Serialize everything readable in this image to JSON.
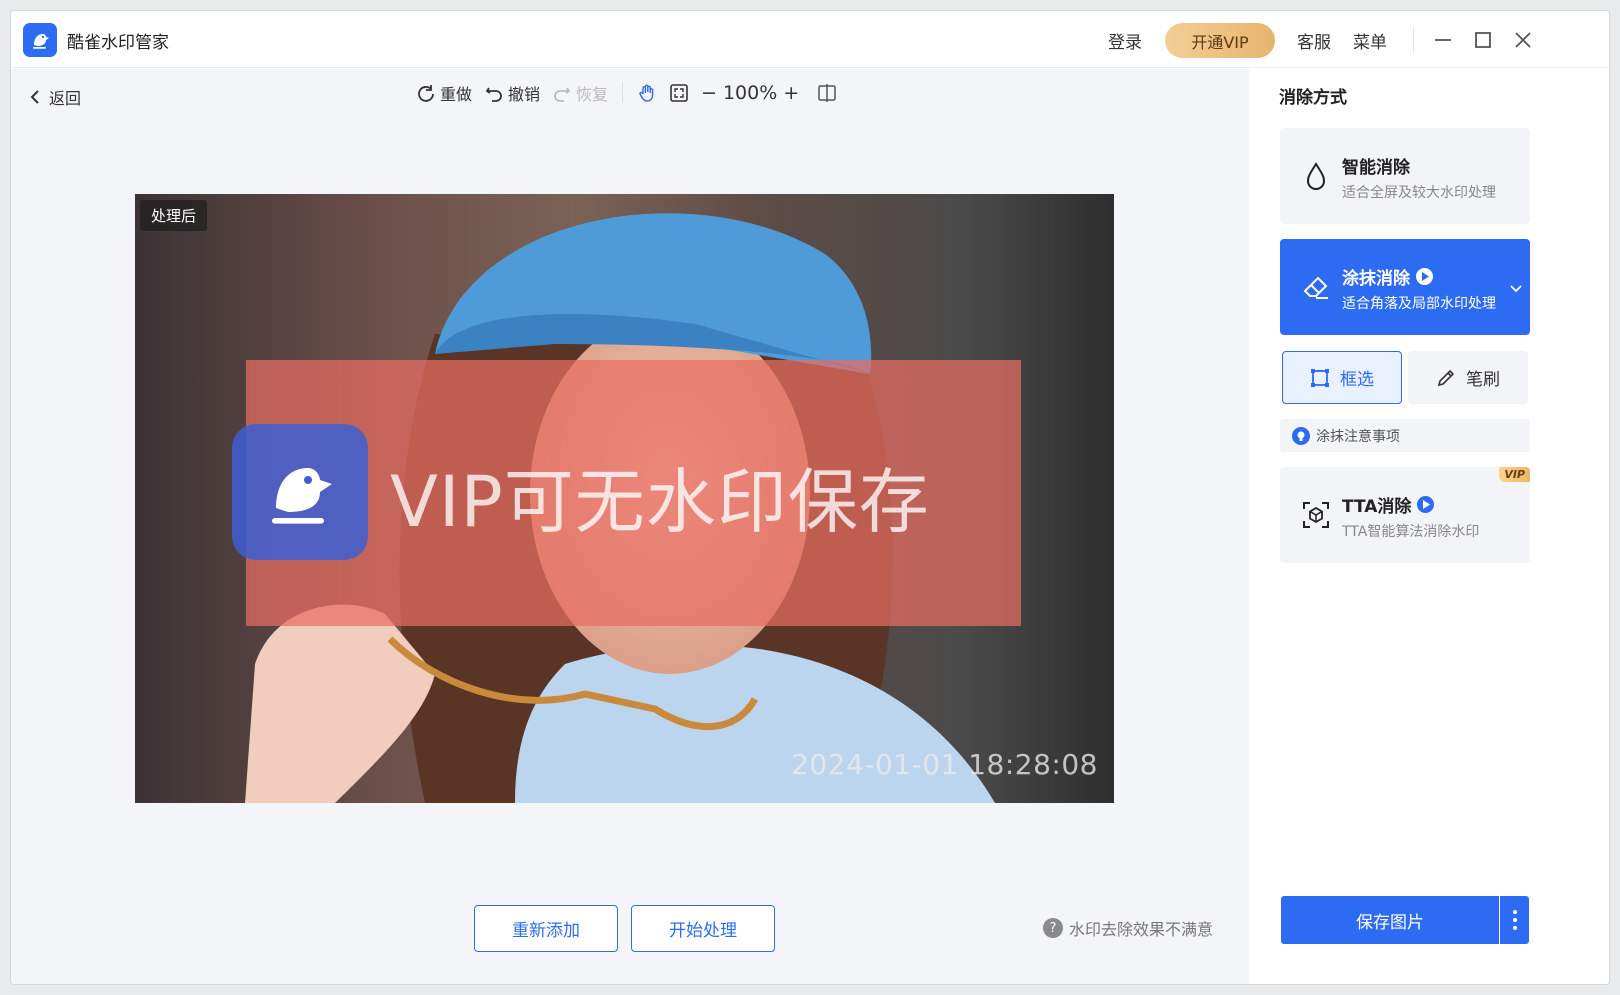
{
  "app": {
    "title": "酷雀水印管家"
  },
  "header": {
    "login": "登录",
    "vip": "开通VIP",
    "service": "客服",
    "menu": "菜单"
  },
  "nav": {
    "back": "返回"
  },
  "toolbar": {
    "redo_label": "重做",
    "undo_label": "撤销",
    "restore_label": "恢复",
    "zoom_level": "100%"
  },
  "preview": {
    "badge": "处理后",
    "watermark_text": "VIP可无水印保存",
    "timestamp": "2024-01-01 18:28:08"
  },
  "actions": {
    "re_add": "重新添加",
    "start": "开始处理",
    "feedback": "水印去除效果不满意"
  },
  "panel": {
    "title": "消除方式",
    "methods": [
      {
        "name": "智能消除",
        "desc": "适合全屏及较大水印处理",
        "icon": "water-drop-icon"
      },
      {
        "name": "涂抹消除",
        "desc": "适合角落及局部水印处理",
        "icon": "eraser-icon",
        "active": true
      },
      {
        "name": "TTA消除",
        "desc": "TTA智能算法消除水印",
        "icon": "scan-cube-icon",
        "tag": "VIP"
      }
    ],
    "modes": {
      "select": "框选",
      "brush": "笔刷"
    },
    "notice": "涂抹注意事项",
    "save": "保存图片"
  },
  "colors": {
    "accent": "#2d6cf2",
    "vip_gold": "#e7b46e",
    "watermark_red": "#e86e62"
  }
}
